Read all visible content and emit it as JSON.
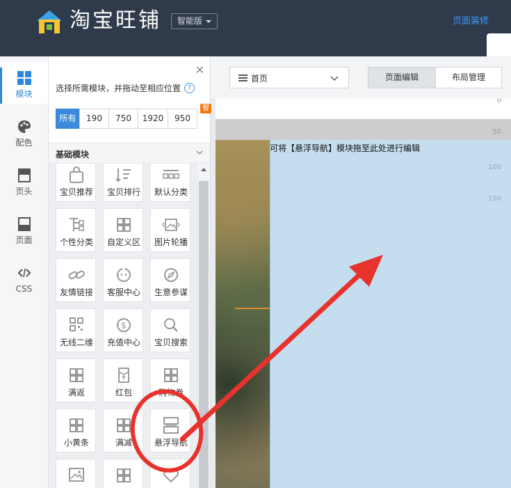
{
  "header": {
    "logo_text": "淘宝旺铺",
    "edition": "智能版",
    "decorate_link": "页面装修"
  },
  "rail": {
    "items": [
      {
        "label": "模块",
        "icon": "module-grid-icon",
        "active": true
      },
      {
        "label": "配色",
        "icon": "palette-icon",
        "active": false
      },
      {
        "label": "页头",
        "icon": "page-header-icon",
        "active": false
      },
      {
        "label": "页面",
        "icon": "page-icon",
        "active": false
      },
      {
        "label": "CSS",
        "icon": "code-icon",
        "active": false
      }
    ]
  },
  "panel": {
    "hint": "选择所需模块，并拖动至相应位置",
    "filters": [
      "所有",
      "190",
      "750",
      "1920",
      "950"
    ],
    "filter_badge": "智能版",
    "section_title": "基础模块",
    "modules": [
      {
        "label": "宝贝推荐",
        "icon": "bag-icon"
      },
      {
        "label": "宝贝排行",
        "icon": "ranking-icon"
      },
      {
        "label": "默认分类",
        "icon": "category-icon"
      },
      {
        "label": "个性分类",
        "icon": "tree-icon"
      },
      {
        "label": "自定义区",
        "icon": "grid-icon"
      },
      {
        "label": "图片轮播",
        "icon": "image-carousel-icon"
      },
      {
        "label": "友情链接",
        "icon": "link-icon"
      },
      {
        "label": "客服中心",
        "icon": "service-icon"
      },
      {
        "label": "生意参谋",
        "icon": "compass-icon"
      },
      {
        "label": "无线二维",
        "icon": "qrcode-icon"
      },
      {
        "label": "充值中心",
        "icon": "dollar-icon"
      },
      {
        "label": "宝贝搜索",
        "icon": "search-icon"
      },
      {
        "label": "满返",
        "icon": "grid-icon"
      },
      {
        "label": "红包",
        "icon": "red-packet-icon"
      },
      {
        "label": "购物券",
        "icon": "grid-icon"
      },
      {
        "label": "小黄条",
        "icon": "grid-icon"
      },
      {
        "label": "满减",
        "icon": "grid-icon"
      },
      {
        "label": "悬浮导航",
        "icon": "floating-nav-icon"
      },
      {
        "label": "",
        "icon": "image-icon"
      },
      {
        "label": "",
        "icon": "grid-icon"
      },
      {
        "label": "",
        "icon": "heart-icon"
      }
    ]
  },
  "toolbar": {
    "page_select": "首页",
    "edit_tab": "页面编辑",
    "layout_tab": "布局管理"
  },
  "canvas": {
    "ruler": [
      "0",
      "50",
      "100",
      "150"
    ],
    "drop_hint": "可将【悬浮导航】模块拖至此处进行编辑"
  },
  "colors": {
    "header_bg": "#2f3a4a",
    "accent_blue": "#3b8ad9",
    "badge_orange": "#f07a12",
    "dropzone_blue": "#c4def0",
    "annotation_red": "#e8322c"
  }
}
